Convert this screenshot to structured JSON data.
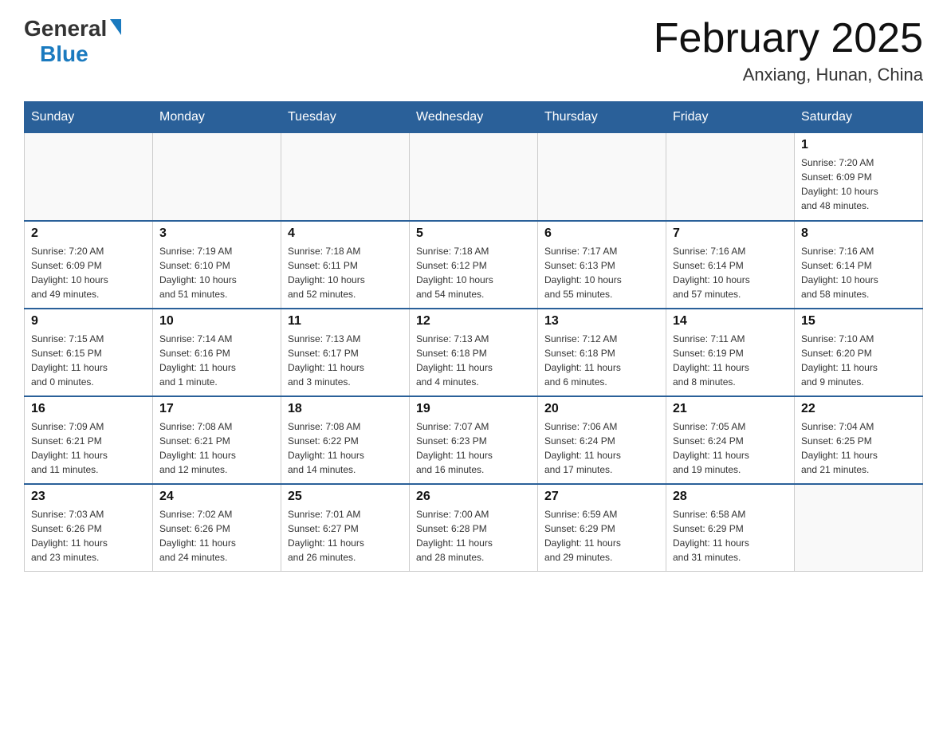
{
  "header": {
    "logo_general": "General",
    "logo_blue": "Blue",
    "month_title": "February 2025",
    "location": "Anxiang, Hunan, China"
  },
  "days_of_week": [
    "Sunday",
    "Monday",
    "Tuesday",
    "Wednesday",
    "Thursday",
    "Friday",
    "Saturday"
  ],
  "weeks": [
    {
      "days": [
        {
          "num": "",
          "info": ""
        },
        {
          "num": "",
          "info": ""
        },
        {
          "num": "",
          "info": ""
        },
        {
          "num": "",
          "info": ""
        },
        {
          "num": "",
          "info": ""
        },
        {
          "num": "",
          "info": ""
        },
        {
          "num": "1",
          "info": "Sunrise: 7:20 AM\nSunset: 6:09 PM\nDaylight: 10 hours\nand 48 minutes."
        }
      ]
    },
    {
      "days": [
        {
          "num": "2",
          "info": "Sunrise: 7:20 AM\nSunset: 6:09 PM\nDaylight: 10 hours\nand 49 minutes."
        },
        {
          "num": "3",
          "info": "Sunrise: 7:19 AM\nSunset: 6:10 PM\nDaylight: 10 hours\nand 51 minutes."
        },
        {
          "num": "4",
          "info": "Sunrise: 7:18 AM\nSunset: 6:11 PM\nDaylight: 10 hours\nand 52 minutes."
        },
        {
          "num": "5",
          "info": "Sunrise: 7:18 AM\nSunset: 6:12 PM\nDaylight: 10 hours\nand 54 minutes."
        },
        {
          "num": "6",
          "info": "Sunrise: 7:17 AM\nSunset: 6:13 PM\nDaylight: 10 hours\nand 55 minutes."
        },
        {
          "num": "7",
          "info": "Sunrise: 7:16 AM\nSunset: 6:14 PM\nDaylight: 10 hours\nand 57 minutes."
        },
        {
          "num": "8",
          "info": "Sunrise: 7:16 AM\nSunset: 6:14 PM\nDaylight: 10 hours\nand 58 minutes."
        }
      ]
    },
    {
      "days": [
        {
          "num": "9",
          "info": "Sunrise: 7:15 AM\nSunset: 6:15 PM\nDaylight: 11 hours\nand 0 minutes."
        },
        {
          "num": "10",
          "info": "Sunrise: 7:14 AM\nSunset: 6:16 PM\nDaylight: 11 hours\nand 1 minute."
        },
        {
          "num": "11",
          "info": "Sunrise: 7:13 AM\nSunset: 6:17 PM\nDaylight: 11 hours\nand 3 minutes."
        },
        {
          "num": "12",
          "info": "Sunrise: 7:13 AM\nSunset: 6:18 PM\nDaylight: 11 hours\nand 4 minutes."
        },
        {
          "num": "13",
          "info": "Sunrise: 7:12 AM\nSunset: 6:18 PM\nDaylight: 11 hours\nand 6 minutes."
        },
        {
          "num": "14",
          "info": "Sunrise: 7:11 AM\nSunset: 6:19 PM\nDaylight: 11 hours\nand 8 minutes."
        },
        {
          "num": "15",
          "info": "Sunrise: 7:10 AM\nSunset: 6:20 PM\nDaylight: 11 hours\nand 9 minutes."
        }
      ]
    },
    {
      "days": [
        {
          "num": "16",
          "info": "Sunrise: 7:09 AM\nSunset: 6:21 PM\nDaylight: 11 hours\nand 11 minutes."
        },
        {
          "num": "17",
          "info": "Sunrise: 7:08 AM\nSunset: 6:21 PM\nDaylight: 11 hours\nand 12 minutes."
        },
        {
          "num": "18",
          "info": "Sunrise: 7:08 AM\nSunset: 6:22 PM\nDaylight: 11 hours\nand 14 minutes."
        },
        {
          "num": "19",
          "info": "Sunrise: 7:07 AM\nSunset: 6:23 PM\nDaylight: 11 hours\nand 16 minutes."
        },
        {
          "num": "20",
          "info": "Sunrise: 7:06 AM\nSunset: 6:24 PM\nDaylight: 11 hours\nand 17 minutes."
        },
        {
          "num": "21",
          "info": "Sunrise: 7:05 AM\nSunset: 6:24 PM\nDaylight: 11 hours\nand 19 minutes."
        },
        {
          "num": "22",
          "info": "Sunrise: 7:04 AM\nSunset: 6:25 PM\nDaylight: 11 hours\nand 21 minutes."
        }
      ]
    },
    {
      "days": [
        {
          "num": "23",
          "info": "Sunrise: 7:03 AM\nSunset: 6:26 PM\nDaylight: 11 hours\nand 23 minutes."
        },
        {
          "num": "24",
          "info": "Sunrise: 7:02 AM\nSunset: 6:26 PM\nDaylight: 11 hours\nand 24 minutes."
        },
        {
          "num": "25",
          "info": "Sunrise: 7:01 AM\nSunset: 6:27 PM\nDaylight: 11 hours\nand 26 minutes."
        },
        {
          "num": "26",
          "info": "Sunrise: 7:00 AM\nSunset: 6:28 PM\nDaylight: 11 hours\nand 28 minutes."
        },
        {
          "num": "27",
          "info": "Sunrise: 6:59 AM\nSunset: 6:29 PM\nDaylight: 11 hours\nand 29 minutes."
        },
        {
          "num": "28",
          "info": "Sunrise: 6:58 AM\nSunset: 6:29 PM\nDaylight: 11 hours\nand 31 minutes."
        },
        {
          "num": "",
          "info": ""
        }
      ]
    }
  ]
}
